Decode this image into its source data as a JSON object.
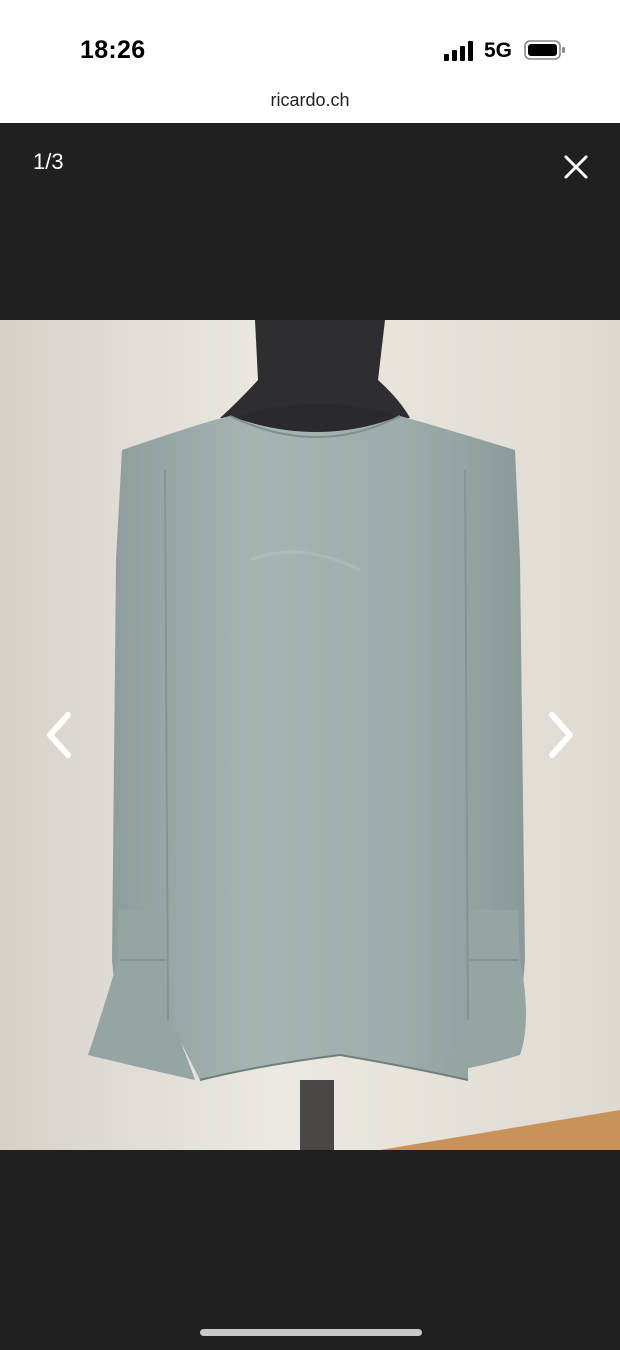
{
  "status_bar": {
    "time": "18:26",
    "network": "5G",
    "signal_icon": "signal-bars-icon",
    "battery_icon": "battery-icon"
  },
  "browser": {
    "url": "ricardo.ch"
  },
  "gallery": {
    "counter": "1/3",
    "close_icon": "close-icon",
    "prev_icon": "chevron-left-icon",
    "next_icon": "chevron-right-icon",
    "photo": "product-photo"
  },
  "colors": {
    "viewer_bg": "#202020",
    "blouse": "#9aaaa9",
    "wall": "#e7e3db",
    "mannequin": "#2e2d2f"
  }
}
